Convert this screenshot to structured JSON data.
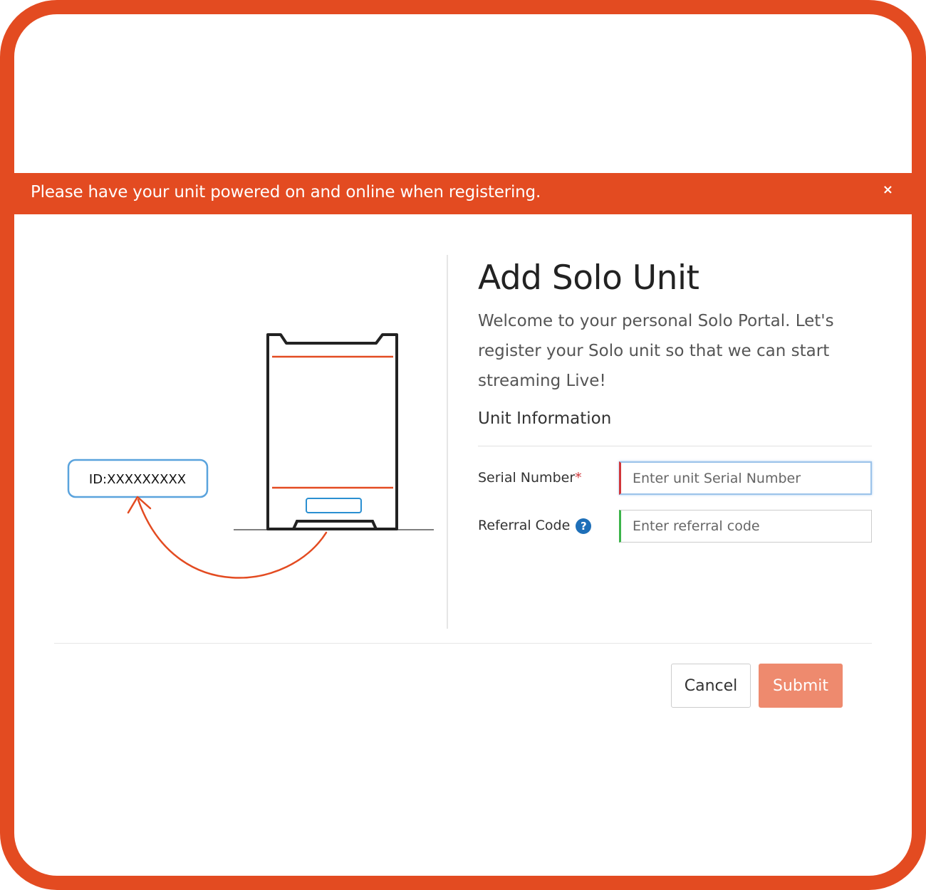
{
  "banner": {
    "message": "Please have your unit powered on and online when registering.",
    "close_icon": "close-icon",
    "close_glyph": "×"
  },
  "illustration": {
    "id_label": "ID:XXXXXXXXX"
  },
  "form": {
    "title": "Add Solo Unit",
    "intro": "Welcome to your personal Solo Portal. Let's register your Solo unit so that we can start streaming Live!",
    "section_title": "Unit Information",
    "serial": {
      "label": "Serial Number",
      "required_mark": "*",
      "placeholder": "Enter unit Serial Number",
      "value": ""
    },
    "referral": {
      "label": "Referral Code",
      "help_icon": "help-icon",
      "help_glyph": "?",
      "placeholder": "Enter referral code",
      "value": ""
    }
  },
  "actions": {
    "cancel_label": "Cancel",
    "submit_label": "Submit"
  },
  "colors": {
    "brand": "#e34b21",
    "submit_disabled": "#ee8a6e",
    "required": "#d1363a",
    "valid": "#3cb44a",
    "help": "#1e6fb8"
  }
}
